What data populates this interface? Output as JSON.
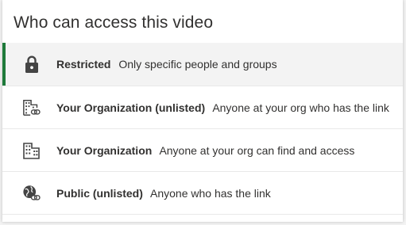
{
  "dialog": {
    "title": "Who can access this video"
  },
  "accent_color": "#1e7a3a",
  "options": [
    {
      "label": "Restricted",
      "description": "Only specific people and groups",
      "icon": "lock-icon",
      "selected": true
    },
    {
      "label": "Your Organization (unlisted)",
      "description": "Anyone at your org who has the link",
      "icon": "building-link-icon",
      "selected": false
    },
    {
      "label": "Your Organization",
      "description": "Anyone at your org can find and access",
      "icon": "building-icon",
      "selected": false
    },
    {
      "label": "Public (unlisted)",
      "description": "Anyone who has the link",
      "icon": "globe-link-icon",
      "selected": false
    }
  ]
}
